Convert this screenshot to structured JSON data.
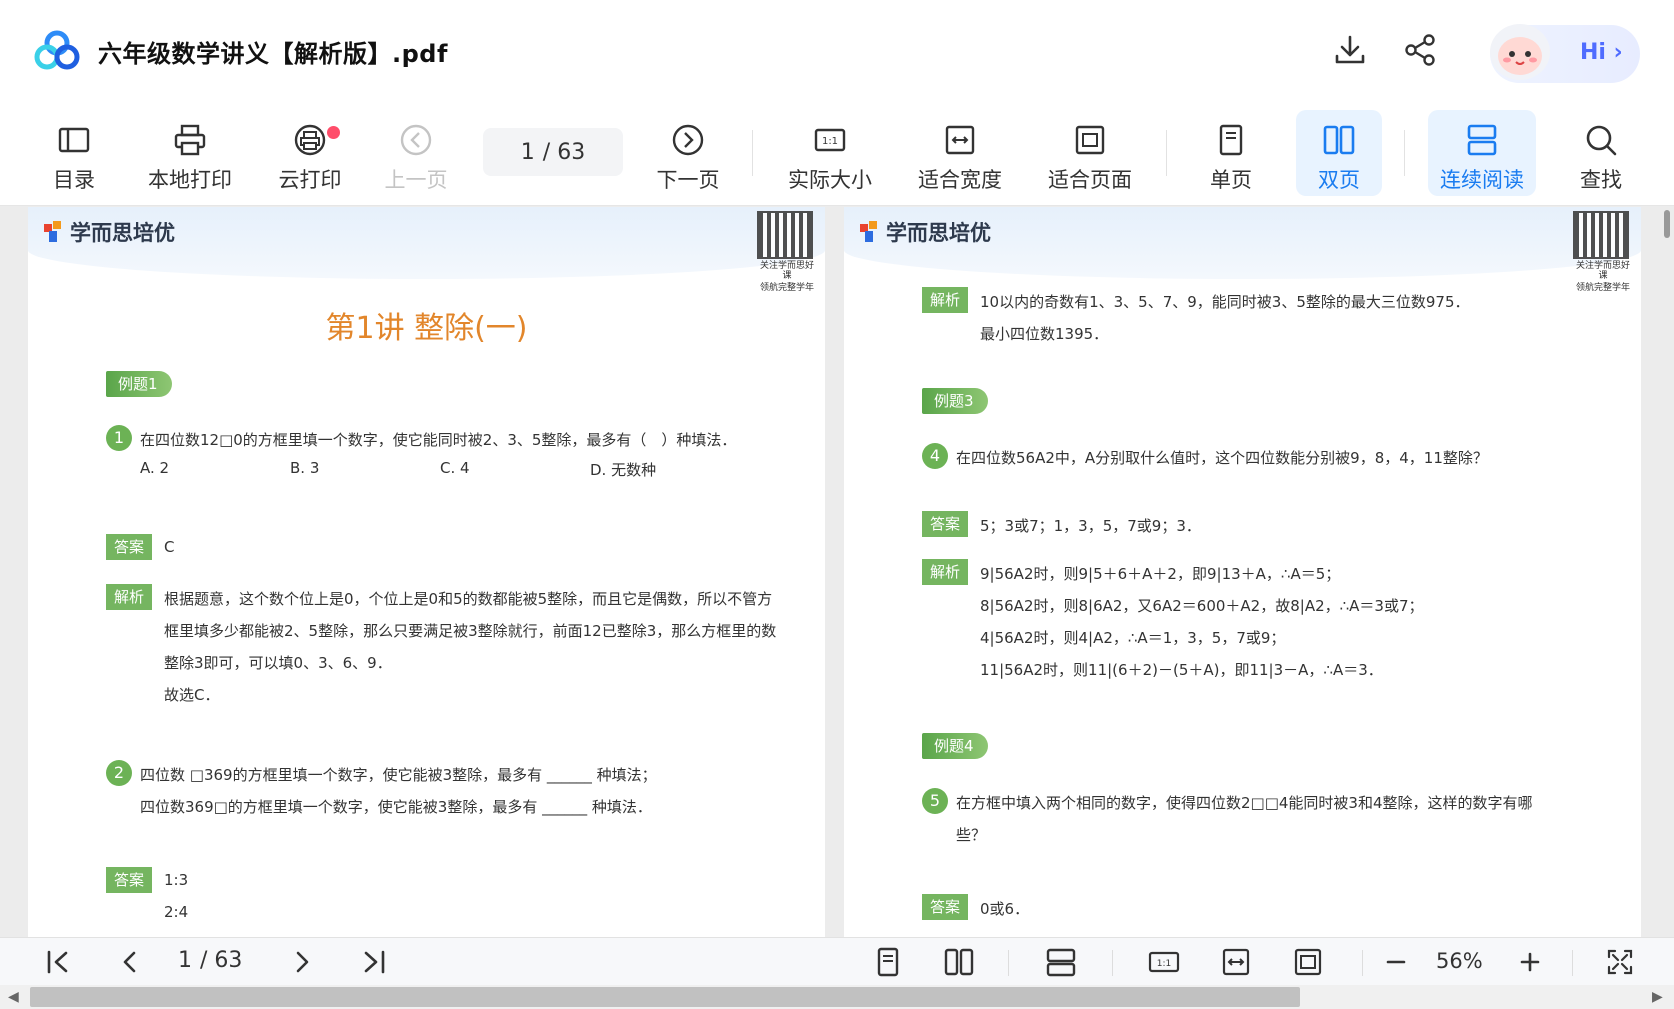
{
  "header": {
    "title": "六年级数学讲义【解析版】.pdf",
    "hi_label": "Hi ›"
  },
  "toolbar": {
    "items": [
      {
        "label": "目录"
      },
      {
        "label": "本地打印"
      },
      {
        "label": "云打印"
      },
      {
        "label": "上一页"
      },
      {
        "label": "下一页"
      },
      {
        "label": "实际大小"
      },
      {
        "label": "适合宽度"
      },
      {
        "label": "适合页面"
      },
      {
        "label": "单页"
      },
      {
        "label": "双页"
      },
      {
        "label": "连续阅读"
      },
      {
        "label": "查找"
      }
    ],
    "page_current": "1",
    "page_total": "/ 63"
  },
  "colors": {
    "accent": "#1a7cf0",
    "active_bg": "#e8f3ff",
    "title_orange": "#e2862b",
    "tag_green": "#75b560"
  },
  "left_page": {
    "brand": "学而思培优",
    "qr_caption_1": "关注学而思好课",
    "qr_caption_2": "领航完整学年",
    "lecture_title": "第1讲 整除(一)",
    "example1_tag": "例题1",
    "q1_num": "1",
    "q1_text": "在四位数12□0的方框里填一个数字，使它能同时被2、3、5整除，最多有（　）种填法．",
    "q1_opt_a": "A. 2",
    "q1_opt_b": "B. 3",
    "q1_opt_c": "C. 4",
    "q1_opt_d": "D. 无数种",
    "answer_tag": "答案",
    "q1_answer": "C",
    "analysis_tag": "解析",
    "q1_analysis_1": "根据题意，这个数个位上是0，个位上是0和5的数都能被5整除，而且它是偶数，所以不管方",
    "q1_analysis_2": "框里填多少都能被2、5整除，那么只要满足被3整除就行，前面12已整除3，那么方框里的数",
    "q1_analysis_3": "整除3即可，可以填0、3、6、9．",
    "q1_analysis_4": "故选C．",
    "q2_num": "2",
    "q2_text_1": "四位数 □369的方框里填一个数字，使它能被3整除，最多有 ______ 种填法；",
    "q2_text_2": "四位数369□的方框里填一个数字，使它能被3整除，最多有 ______ 种填法．",
    "q2_answer_1": "1:3",
    "q2_answer_2": "2:4"
  },
  "right_page": {
    "brand": "学而思培优",
    "qr_caption_1": "关注学而思好课",
    "qr_caption_2": "领航完整学年",
    "analysis_tag": "解析",
    "top_analysis_1": "10以内的奇数有1、3、5、7、9，能同时被3、5整除的最大三位数975．",
    "top_analysis_2": "最小四位数1395．",
    "example3_tag": "例题3",
    "q4_num": "4",
    "q4_text": "在四位数56A2中，A分别取什么值时，这个四位数能分别被9，8，4，11整除？",
    "answer_tag": "答案",
    "q4_answer": "5；3或7；1，3，5，7或9；3．",
    "q4_analysis_1": "9|56A2时，则9|5＋6＋A＋2，即9|13＋A，∴A＝5；",
    "q4_analysis_2": "8|56A2时，则8|6A2，又6A2＝600＋A2，故8|A2，∴A＝3或7；",
    "q4_analysis_3": "4|56A2时，则4|A2，∴A＝1，3，5，7或9；",
    "q4_analysis_4": "11|56A2时，则11|(6＋2)－(5＋A)，即11|3－A，∴A＝3．",
    "example4_tag": "例题4",
    "q5_num": "5",
    "q5_text_1": "在方框中填入两个相同的数字，使得四位数2□□4能同时被3和4整除，这样的数字有哪",
    "q5_text_2": "些？",
    "q5_answer": "0或6．"
  },
  "bottombar": {
    "page_current": "1",
    "page_total": "/ 63",
    "zoom": "56%"
  }
}
